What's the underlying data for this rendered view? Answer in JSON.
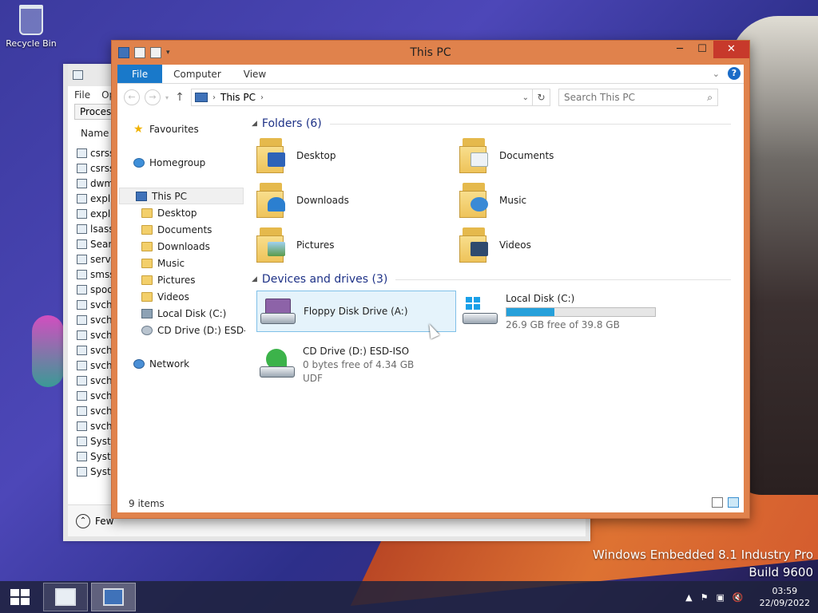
{
  "desktop": {
    "recycle_bin_label": "Recycle Bin",
    "watermark_line1": "Windows Embedded 8.1 Industry Pro",
    "watermark_line2": "Build 9600"
  },
  "back_window": {
    "menu": [
      "File",
      "Op"
    ],
    "tab": "Processe",
    "column_header": "Name",
    "rows": [
      "csrss.",
      "csrss.",
      "dwm.",
      "explo",
      "explo",
      "lsass.",
      "Searcl",
      "servic",
      "smss.",
      "spool",
      "svcho",
      "svcho",
      "svcho",
      "svcho",
      "svcho",
      "svcho",
      "svcho",
      "svcho",
      "svcho",
      "Systen",
      "Systen",
      "Systen"
    ],
    "footer_label": "Few"
  },
  "window": {
    "title": "This PC",
    "ribbon_tabs": [
      "File",
      "Computer",
      "View"
    ],
    "address_path": "This PC",
    "address_sep": "›",
    "search_placeholder": "Search This PC",
    "nav": {
      "favourites": "Favourites",
      "homegroup": "Homegroup",
      "this_pc": "This PC",
      "sub_items": [
        "Desktop",
        "Documents",
        "Downloads",
        "Music",
        "Pictures",
        "Videos",
        "Local Disk (C:)",
        "CD Drive (D:) ESD-IS"
      ],
      "network": "Network"
    },
    "folders_header": "Folders (6)",
    "folders": [
      "Desktop",
      "Documents",
      "Downloads",
      "Music",
      "Pictures",
      "Videos"
    ],
    "devices_header": "Devices and drives (3)",
    "devices": {
      "floppy": {
        "name": "Floppy Disk Drive (A:)"
      },
      "local": {
        "name": "Local Disk (C:)",
        "free_text": "26.9 GB free of 39.8 GB",
        "used_fraction": 0.32
      },
      "cd": {
        "name": "CD Drive (D:) ESD-ISO",
        "free_text": "0 bytes free of 4.34 GB",
        "fs": "UDF"
      }
    },
    "status_text": "9 items"
  },
  "taskbar": {
    "time": "03:59",
    "date": "22/09/2022"
  },
  "colors": {
    "window_frame": "#e0824c",
    "file_tab": "#1979ca",
    "close_button": "#c7392b",
    "usage_fill": "#26a0da",
    "group_header": "#1e3287"
  }
}
